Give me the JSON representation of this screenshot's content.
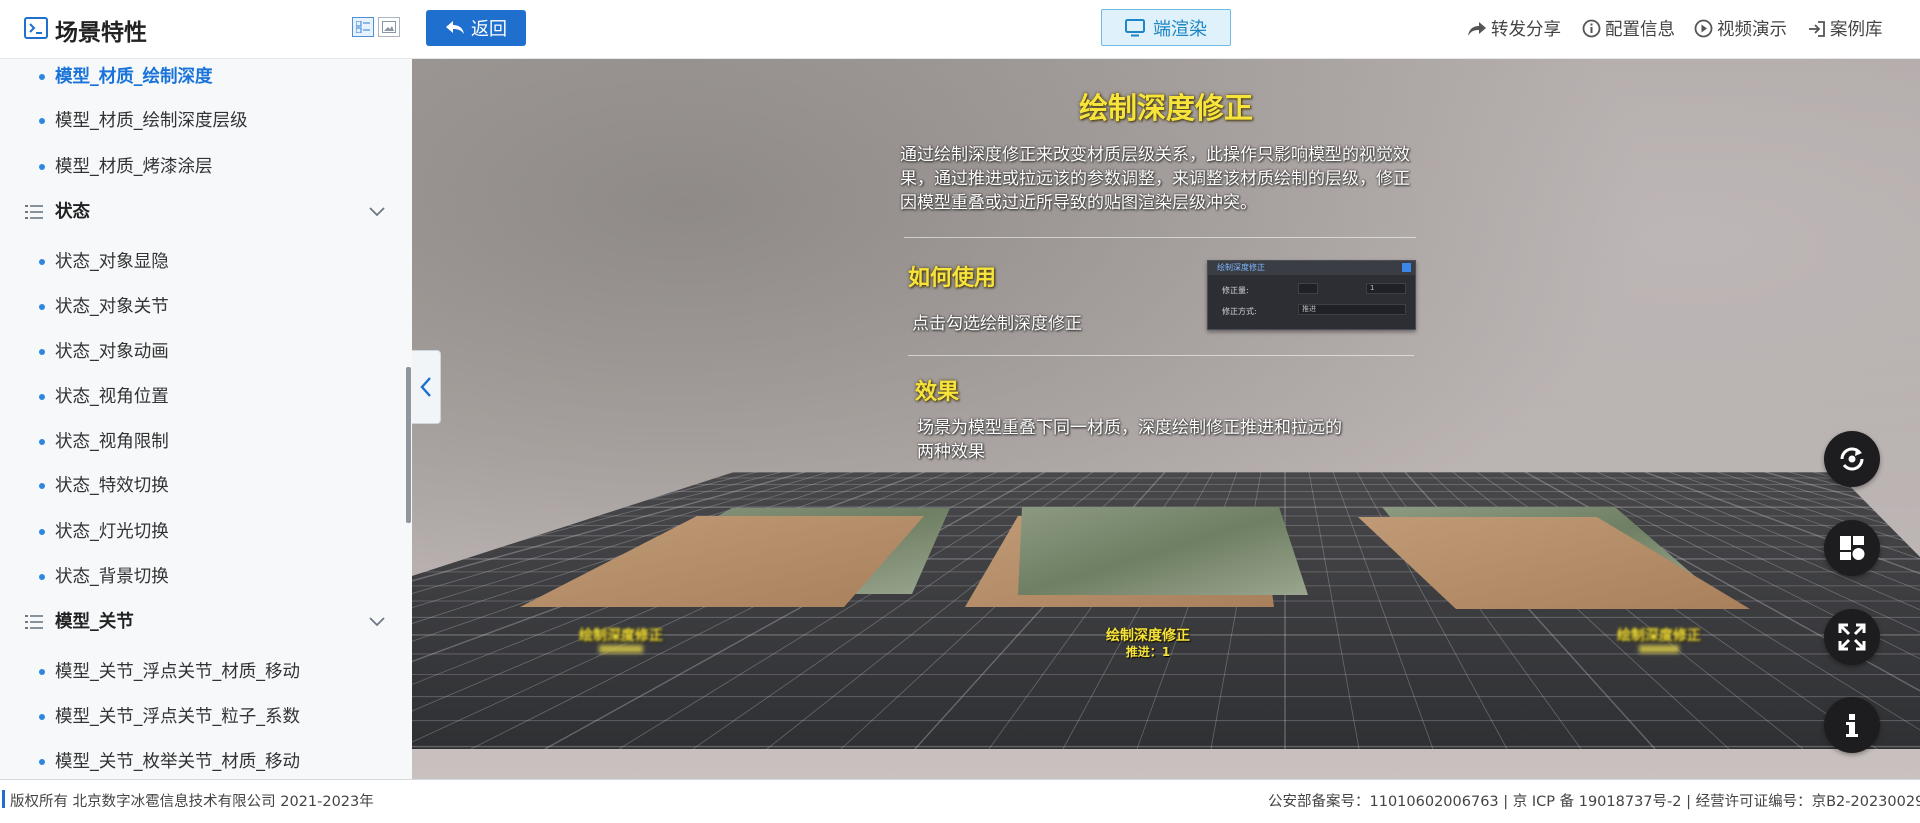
{
  "colors": {
    "accent": "#1f6fce",
    "active_item": "#1a73d9",
    "bullet": "#2e86de",
    "scene_heading": "#f7e43b",
    "fab_bg": "#1d1d1f"
  },
  "sidebar": {
    "title": "场景特性",
    "material_items": [
      {
        "label": "模型_材质_绘制深度",
        "active": true
      },
      {
        "label": "模型_材质_绘制深度层级",
        "active": false
      },
      {
        "label": "模型_材质_烤漆涂层",
        "active": false
      }
    ],
    "sections": [
      {
        "title": "状态",
        "items": [
          "状态_对象显隐",
          "状态_对象关节",
          "状态_对象动画",
          "状态_视角位置",
          "状态_视角限制",
          "状态_特效切换",
          "状态_灯光切换",
          "状态_背景切换"
        ]
      },
      {
        "title": "模型_关节",
        "items": [
          "模型_关节_浮点关节_材质_移动",
          "模型_关节_浮点关节_粒子_系数",
          "模型_关节_枚举关节_材质_移动"
        ]
      }
    ]
  },
  "topbar": {
    "back_label": "返回",
    "render_label": "端渲染",
    "links": [
      {
        "label": "转发分享",
        "icon": "share-icon"
      },
      {
        "label": "配置信息",
        "icon": "info-circle-icon"
      },
      {
        "label": "视频演示",
        "icon": "play-circle-icon"
      },
      {
        "label": "案例库",
        "icon": "enter-icon"
      }
    ]
  },
  "scene": {
    "title": "绘制深度修正",
    "description": "通过绘制深度修正来改变材质层级关系，此操作只影响模型的视觉效果，通过推进或拉远该的参数调整，来调整该材质绘制的层级，修正因模型重叠或过近所导致的贴图渲染层级冲突。",
    "howto_heading": "如何使用",
    "howto_text": "点击勾选绘制深度修正",
    "panel": {
      "title": "绘制深度修正",
      "amount_label": "修正量:",
      "amount_value": "1",
      "mode_label": "修正方式:",
      "mode_value": "推进"
    },
    "effect_heading": "效果",
    "effect_text_line1": "场景为模型重叠下同一材质，深度绘制修正推进和拉远的",
    "effect_text_line2": "两种效果",
    "plane_labels": [
      {
        "label": "绘制深度修正",
        "sub": ""
      },
      {
        "label": "绘制深度修正",
        "sub": "推进：1"
      },
      {
        "label": "绘制深度修正",
        "sub": ""
      }
    ]
  },
  "fabs": [
    "rotate-icon",
    "layout-icon",
    "fullscreen-icon",
    "info-icon"
  ],
  "footer": {
    "copyright": "版权所有 北京数字冰雹信息技术有限公司 2021-2023年",
    "records": "公安部备案号：11010602006763 | 京 ICP 备 19018737号-2 | 经营许可证编号：京B2-20230029"
  }
}
